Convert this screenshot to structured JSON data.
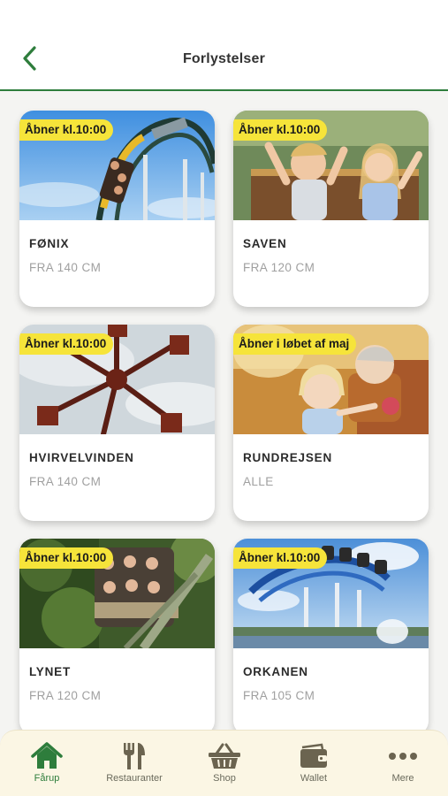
{
  "header": {
    "title": "Forlystelser"
  },
  "rides": [
    {
      "badge": "Åbner kl.10:00",
      "name": "FØNIX",
      "requirement": "FRA 140 CM"
    },
    {
      "badge": "Åbner kl.10:00",
      "name": "SAVEN",
      "requirement": "FRA 120 CM"
    },
    {
      "badge": "Åbner kl.10:00",
      "name": "HVIRVELVINDEN",
      "requirement": "FRA 140 CM"
    },
    {
      "badge": "Åbner i løbet af maj",
      "name": "RUNDREJSEN",
      "requirement": "ALLE"
    },
    {
      "badge": "Åbner kl.10:00",
      "name": "LYNET",
      "requirement": "FRA 120 CM"
    },
    {
      "badge": "Åbner kl.10:00",
      "name": "ORKANEN",
      "requirement": "FRA 105 CM"
    }
  ],
  "tabs": [
    {
      "label": "Fårup",
      "icon": "home-icon",
      "active": true
    },
    {
      "label": "Restauranter",
      "icon": "fork-knife-icon",
      "active": false
    },
    {
      "label": "Shop",
      "icon": "basket-icon",
      "active": false
    },
    {
      "label": "Wallet",
      "icon": "wallet-icon",
      "active": false
    },
    {
      "label": "Mere",
      "icon": "more-dots-icon",
      "active": false
    }
  ],
  "colors": {
    "accent": "#2e7d3c",
    "badge": "#f6e43a",
    "tabbar": "#fbf6e4",
    "inactive_icon": "#6b6450"
  }
}
